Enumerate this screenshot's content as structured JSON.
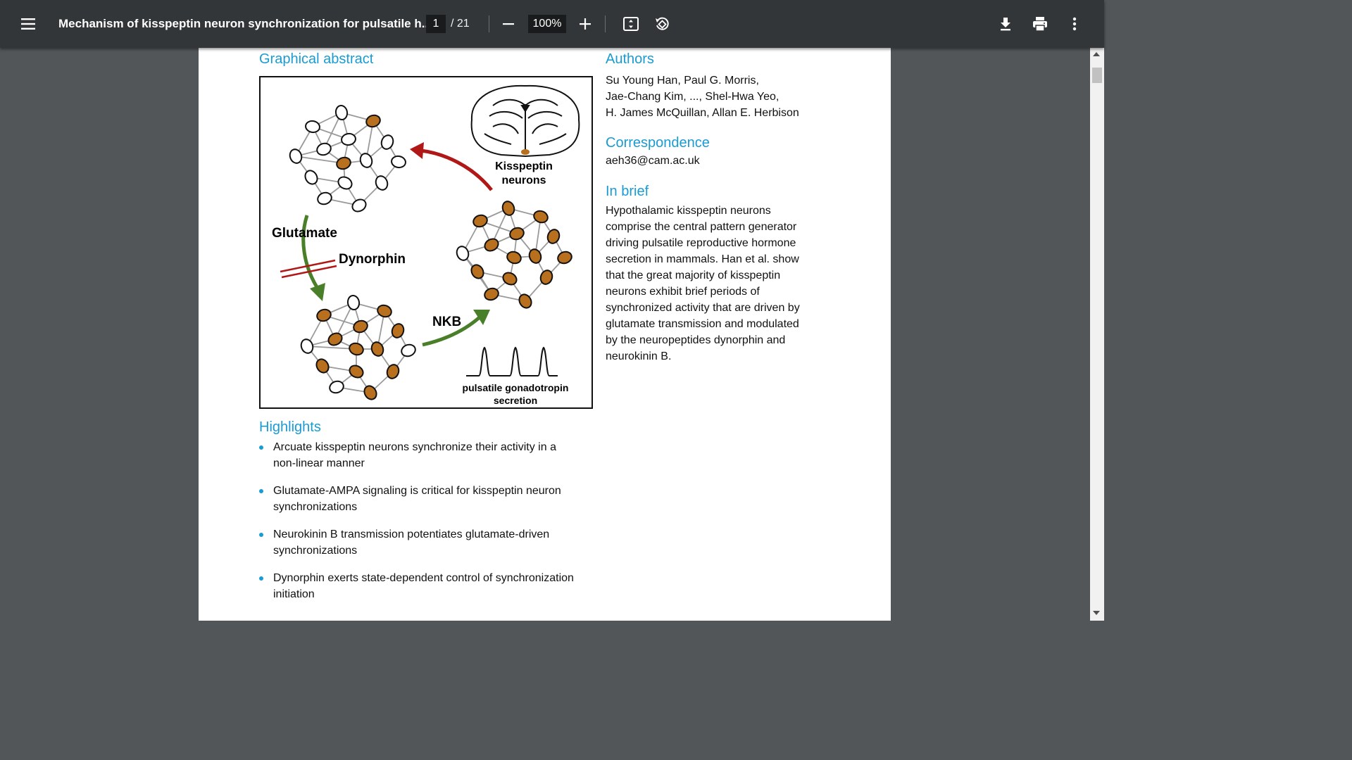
{
  "toolbar": {
    "title": "Mechanism of kisspeptin neuron synchronization for pulsatile h...",
    "page_current": "1",
    "page_total": "/ 21",
    "zoom": "100%",
    "icons": {
      "menu": "menu-icon",
      "zoom_out": "minus-icon",
      "zoom_in": "plus-icon",
      "fit": "fit-page-icon",
      "rotate": "rotate-icon",
      "download": "download-icon",
      "print": "print-icon",
      "more": "more-vertical-icon"
    }
  },
  "page": {
    "graphical_abstract_heading": "Graphical abstract",
    "abstract_figure": {
      "kisspeptin_label_1": "Kisspeptin",
      "kisspeptin_label_2": "neurons",
      "glutamate": "Glutamate",
      "dynorphin": "Dynorphin",
      "nkb": "NKB",
      "pulsatile_1": "pulsatile gonadotropin",
      "pulsatile_2": "secretion"
    },
    "authors_heading": "Authors",
    "authors_lines": [
      "Su Young Han, Paul G. Morris,",
      "Jae-Chang Kim, ..., Shel-Hwa Yeo,",
      "H. James McQuillan, Allan E. Herbison"
    ],
    "correspondence_heading": "Correspondence",
    "correspondence_email": "aeh36@cam.ac.uk",
    "inbrief_heading": "In brief",
    "inbrief_lines": [
      "Hypothalamic kisspeptin neurons",
      "comprise the central pattern generator",
      "driving pulsatile reproductive hormone",
      "secretion in mammals. Han et al. show",
      "that the great majority of kisspeptin",
      "neurons exhibit brief periods of",
      "synchronized activity that are driven by",
      "glutamate transmission and modulated",
      "by the neuropeptides dynorphin and",
      "neurokinin B."
    ],
    "highlights_heading": "Highlights",
    "highlights": [
      {
        "line1": "Arcuate kisspeptin neurons synchronize their activity in a",
        "line2": "non-linear manner"
      },
      {
        "line1": "Glutamate-AMPA signaling is critical for kisspeptin neuron",
        "line2": "synchronizations"
      },
      {
        "line1": "Neurokinin B transmission potentiates glutamate-driven",
        "line2": "synchronizations"
      },
      {
        "line1": "Dynorphin exerts state-dependent control of synchronization",
        "line2": "initiation"
      }
    ]
  },
  "colors": {
    "toolbar_bg": "#323639",
    "viewer_bg": "#525659",
    "heading_blue": "#1a9bd1",
    "neuron_active": "#b8701e",
    "arrow_red": "#b01818",
    "arrow_green": "#4a7f2a"
  }
}
